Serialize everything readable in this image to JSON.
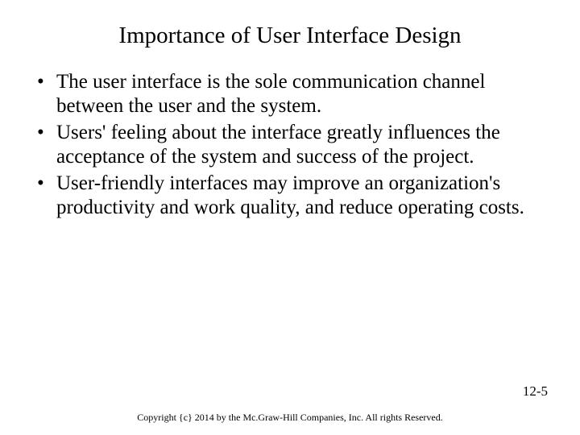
{
  "title": "Importance of User Interface Design",
  "bullets": [
    "The user interface is the sole communication channel between the user and the system.",
    "Users' feeling about the interface greatly influences the acceptance of the system and success of the project.",
    "User-friendly interfaces may improve an organization's productivity and work quality, and reduce operating costs."
  ],
  "pageNumber": "12-5",
  "copyright": "Copyright {c} 2014 by the Mc.Graw-Hill Companies, Inc. All rights Reserved."
}
